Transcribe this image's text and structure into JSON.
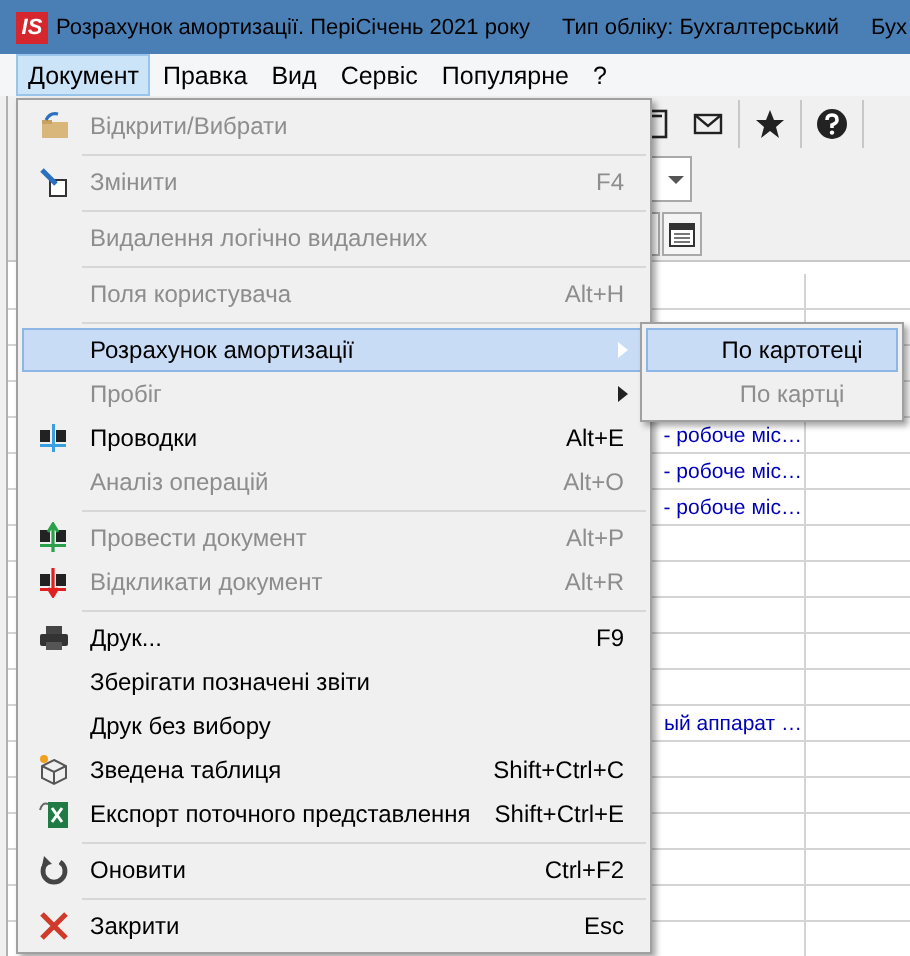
{
  "window": {
    "logo": "IS",
    "title": "Розрахунок амортизації. ПеріСічень 2021 року",
    "accounting_type": "Тип обліку: Бухгалтерський",
    "title_extra": "Бух"
  },
  "menu_bar": [
    {
      "label": "Документ",
      "selected": true
    },
    {
      "label": "Правка",
      "selected": false
    },
    {
      "label": "Вид",
      "selected": false
    },
    {
      "label": "Сервіс",
      "selected": false
    },
    {
      "label": "Популярне",
      "selected": false
    },
    {
      "label": "?",
      "selected": false
    }
  ],
  "document_menu": {
    "items": [
      {
        "kind": "item",
        "label": "Відкрити/Вибрати",
        "disabled": true,
        "selected": false,
        "has_submenu": false
      },
      {
        "kind": "separator"
      },
      {
        "kind": "item",
        "label": "Змінити",
        "shortcut": "F4",
        "disabled": true,
        "selected": false,
        "has_submenu": false
      },
      {
        "kind": "separator"
      },
      {
        "kind": "item",
        "label": "Видалення логічно видалених",
        "disabled": true,
        "selected": false,
        "has_submenu": false
      },
      {
        "kind": "separator"
      },
      {
        "kind": "item",
        "label": "Поля користувача",
        "shortcut": "Alt+H",
        "disabled": true,
        "selected": false,
        "has_submenu": false
      },
      {
        "kind": "separator"
      },
      {
        "kind": "item",
        "label": "Розрахунок амортизації",
        "disabled": false,
        "selected": true,
        "has_submenu": true
      },
      {
        "kind": "item",
        "label": "Пробіг",
        "disabled": true,
        "selected": false,
        "has_submenu": true
      },
      {
        "kind": "item",
        "label": "Проводки",
        "shortcut": "Alt+E",
        "disabled": false,
        "selected": false,
        "has_submenu": false
      },
      {
        "kind": "item",
        "label": "Аналіз операцій",
        "shortcut": "Alt+O",
        "disabled": true,
        "selected": false,
        "has_submenu": false
      },
      {
        "kind": "separator"
      },
      {
        "kind": "item",
        "label": "Провести документ",
        "shortcut": "Alt+P",
        "disabled": true,
        "selected": false,
        "has_submenu": false
      },
      {
        "kind": "item",
        "label": "Відкликати документ",
        "shortcut": "Alt+R",
        "disabled": true,
        "selected": false,
        "has_submenu": false
      },
      {
        "kind": "separator"
      },
      {
        "kind": "item",
        "label": "Друк...",
        "shortcut": "F9",
        "disabled": false,
        "selected": false,
        "has_submenu": false
      },
      {
        "kind": "item",
        "label": "Зберігати позначені звіти",
        "disabled": false,
        "selected": false,
        "has_submenu": false
      },
      {
        "kind": "item",
        "label": "Друк без вибору",
        "disabled": false,
        "selected": false,
        "has_submenu": false
      },
      {
        "kind": "item",
        "label": "Зведена таблиця",
        "shortcut": "Shift+Ctrl+C",
        "disabled": false,
        "selected": false,
        "has_submenu": false
      },
      {
        "kind": "item",
        "label": "Експорт поточного представлення",
        "shortcut": "Shift+Ctrl+E",
        "disabled": false,
        "selected": false,
        "has_submenu": false
      },
      {
        "kind": "separator"
      },
      {
        "kind": "item",
        "label": "Оновити",
        "shortcut": "Ctrl+F2",
        "disabled": false,
        "selected": false,
        "has_submenu": false
      },
      {
        "kind": "separator"
      },
      {
        "kind": "item",
        "label": "Закрити",
        "shortcut": "Esc",
        "disabled": false,
        "selected": false,
        "has_submenu": false
      }
    ]
  },
  "submenu": {
    "items": [
      {
        "label": "По картотеці",
        "selected": true,
        "disabled": false
      },
      {
        "label": "По картці",
        "selected": false,
        "disabled": true
      }
    ]
  },
  "table": {
    "rows": [
      {
        "column_2": "- робоче міс…"
      },
      {
        "column_2": "- робоче міс…"
      },
      {
        "column_2": "- робоче міс…"
      },
      {
        "column_2": "ый аппарат …"
      }
    ]
  }
}
